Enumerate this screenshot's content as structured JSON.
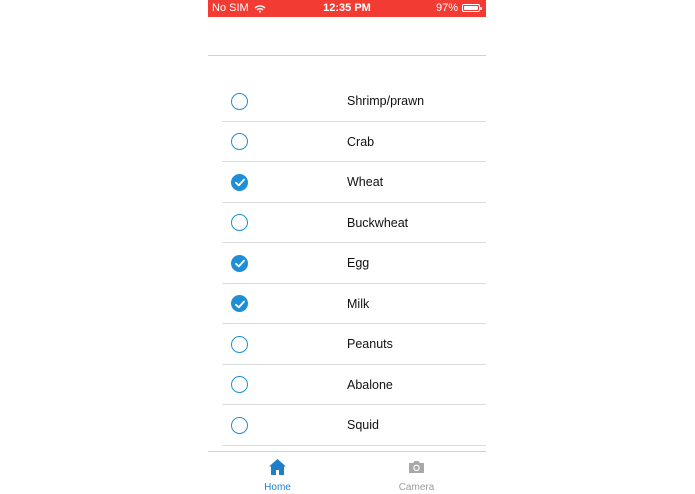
{
  "status_bar": {
    "carrier": "No SIM",
    "time": "12:35 PM",
    "battery": "97%",
    "battery_level": 0.97,
    "background_color": "#f23b33"
  },
  "accent_color": "#1e8fd6",
  "allergens": [
    {
      "label": "Shrimp/prawn",
      "checked": false
    },
    {
      "label": "Crab",
      "checked": false
    },
    {
      "label": "Wheat",
      "checked": true
    },
    {
      "label": "Buckwheat",
      "checked": false
    },
    {
      "label": "Egg",
      "checked": true
    },
    {
      "label": "Milk",
      "checked": true
    },
    {
      "label": "Peanuts",
      "checked": false
    },
    {
      "label": "Abalone",
      "checked": false
    },
    {
      "label": "Squid",
      "checked": false
    }
  ],
  "tab_bar": {
    "tabs": [
      {
        "label": "Home",
        "icon": "home-icon",
        "active": true
      },
      {
        "label": "Camera",
        "icon": "camera-icon",
        "active": false
      }
    ]
  }
}
